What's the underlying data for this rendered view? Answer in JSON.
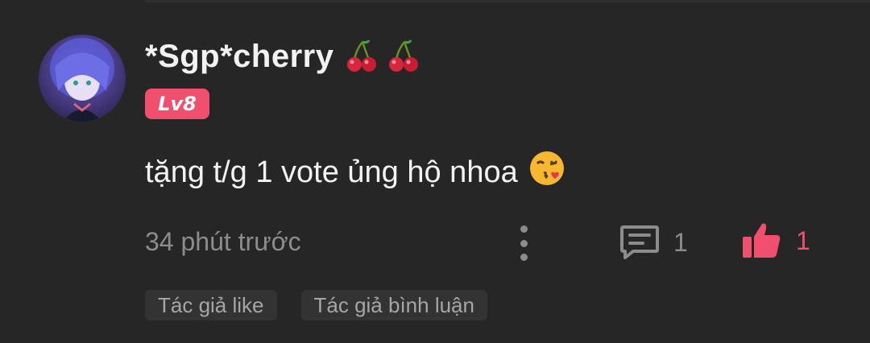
{
  "user": {
    "name": "*Sgp*cherry",
    "badges": [
      "cherry-icon",
      "cherry-icon"
    ],
    "level": "Lv8",
    "avatar_icon": "anime-avatar"
  },
  "comment": {
    "text": "tặng t/g 1 vote ủng hộ nhoa",
    "emoji": "kissing-face-icon"
  },
  "meta": {
    "timestamp": "34 phút trước",
    "reply_count": "1",
    "like_count": "1"
  },
  "tags": [
    {
      "label": "Tác giả like"
    },
    {
      "label": "Tác giả bình luận"
    }
  ],
  "colors": {
    "background": "#262626",
    "accent": "#f0506e",
    "muted_text": "#8c8c8c",
    "primary_text": "#f2f2f2"
  }
}
